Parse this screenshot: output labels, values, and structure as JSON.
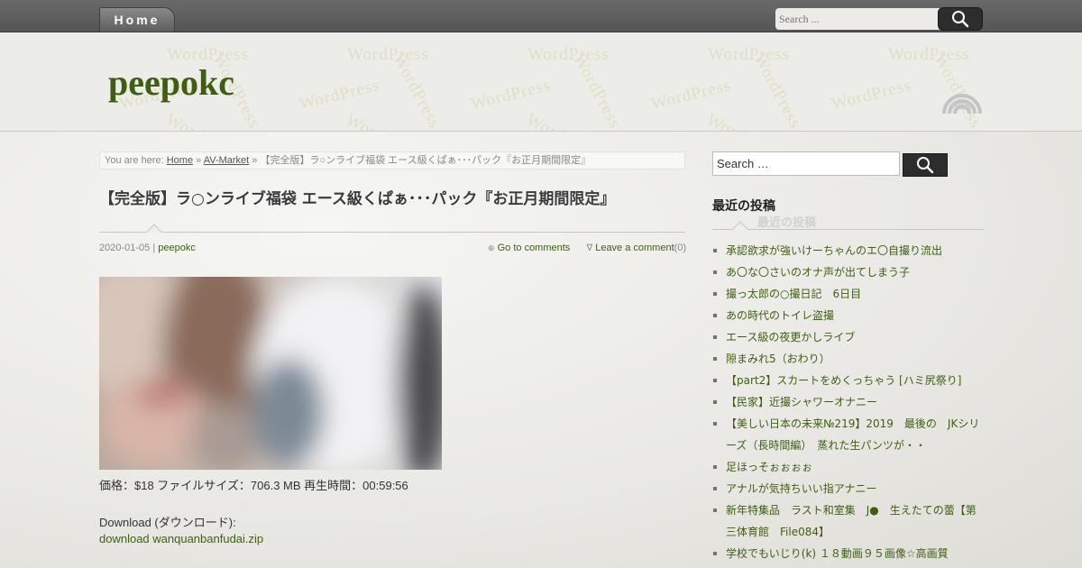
{
  "nav": {
    "home_label": "Home"
  },
  "top_search": {
    "placeholder": "Search ..."
  },
  "header": {
    "site_title": "peepokc",
    "watermark_text": "WordPress",
    "rss_label": "RSS"
  },
  "breadcrumb": {
    "prefix": "You are here:",
    "home": "Home",
    "sep": "»",
    "category": "AV-Market",
    "current": "【完全版】ラ○ンライブ福袋 エース級くぱぁ･･･パック『お正月期間限定』"
  },
  "post": {
    "title": "【完全版】ラ○ンライブ福袋 エース級くぱぁ･･･パック『お正月期間限定』",
    "date": "2020-01-05",
    "meta_sep": "|",
    "author": "peepokc",
    "comments_link": "Go to comments",
    "leave_comment": "Leave a comment",
    "comment_count": "(0)",
    "info_line": "価格：$18 ファイルサイズ：706.3 MB 再生時間：00:59:56",
    "download_label": "Download (ダウンロード):",
    "download_link": "download wanquanbanfudai.zip"
  },
  "sidebar": {
    "search_value": "Search …",
    "widget_title": "最近の投稿",
    "recent_posts": [
      "承認欲求が強いけーちゃんのエ〇自撮り流出",
      "あ〇な〇さいのオナ声が出てしまう子",
      "撮っ太郎の○撮日記　6日目",
      "あの時代のトイレ盗撮",
      "エース級の夜更かしライブ",
      "隙まみれ5（おわり）",
      "【part2】スカートをめくっちゃう [ハミ尻祭り]",
      "【民家】近撮シャワーオナニー",
      "【美しい日本の未来№219】2019　最後の　JKシリーズ（長時間編）　蒸れた生パンツが・・",
      "足ほっそぉぉぉぉ",
      "アナルが気持ちいい指アナニー",
      "新年特集品　ラスト和室集　J●　生えたての蕾【第三体育館　File084】",
      "学校でもいじり(k) １８動画９５画像☆高画質"
    ]
  }
}
